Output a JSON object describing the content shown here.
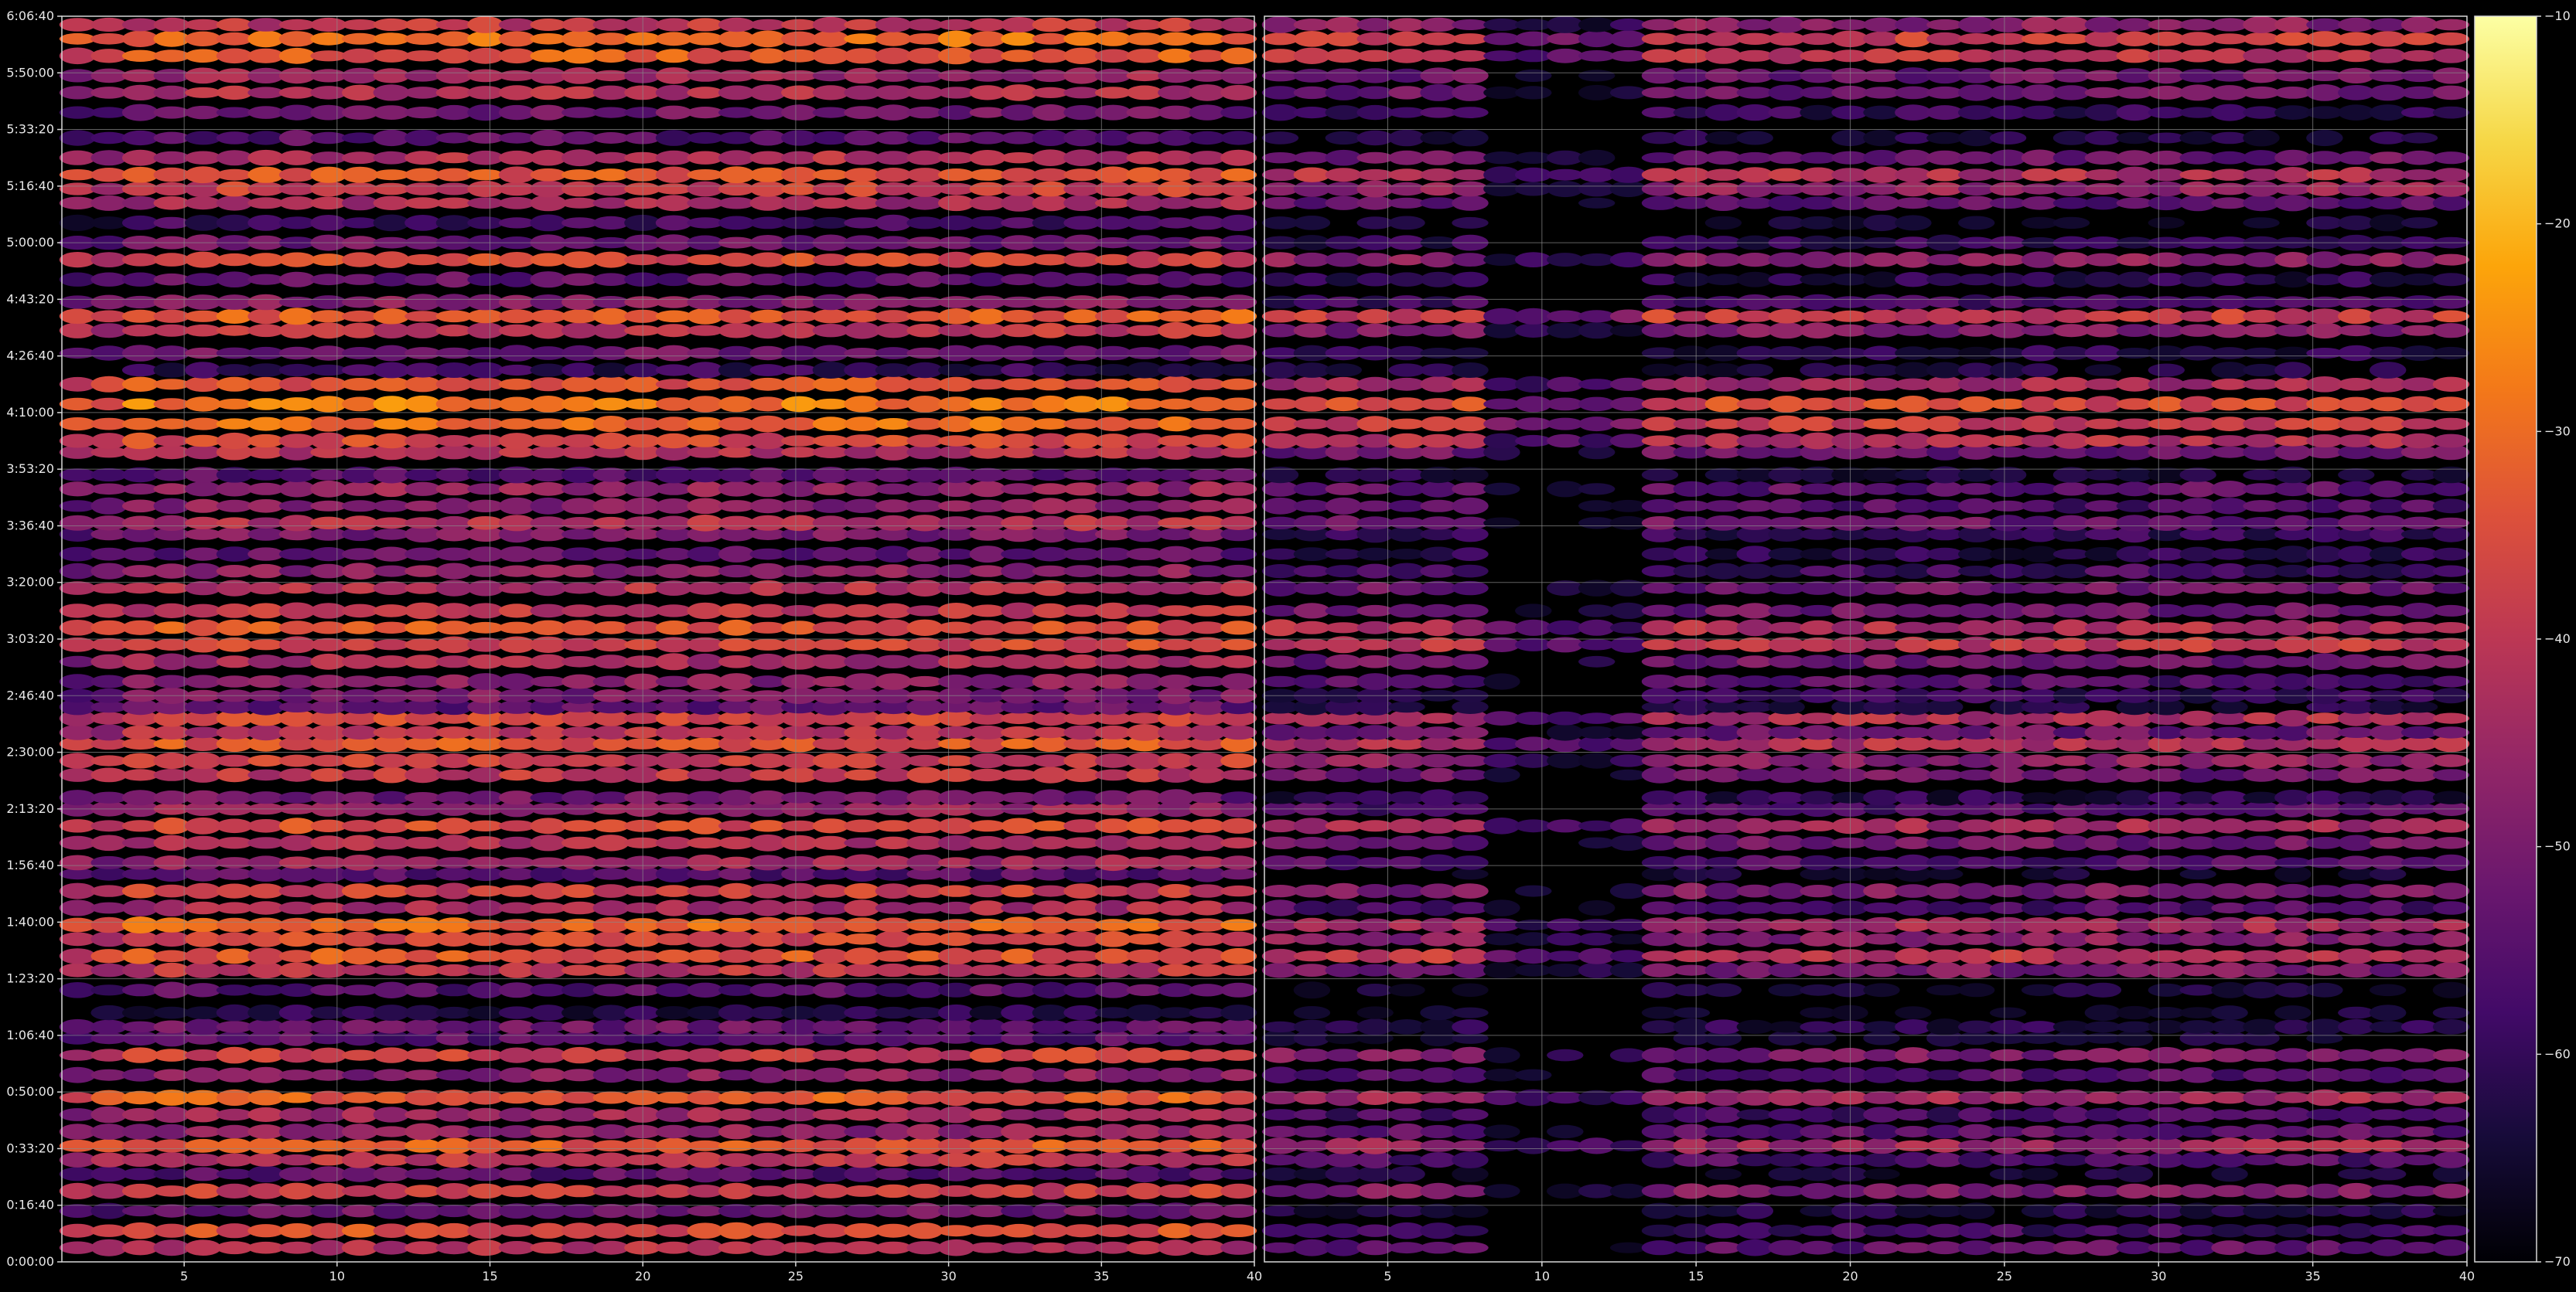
{
  "chart_data": {
    "type": "heatmap",
    "colormap": "inferno",
    "background": "#000000",
    "grid": true,
    "panels": [
      {
        "name": "left",
        "xlim": [
          1,
          40
        ],
        "xticks": [
          5,
          10,
          15,
          20,
          25,
          30,
          35,
          40
        ],
        "ylim": [
          0,
          22000
        ],
        "yticks": [
          0,
          1000,
          2000,
          3000,
          4000,
          5000,
          6000,
          7000,
          8000,
          9000,
          10000,
          11000,
          12000,
          13000,
          14000,
          15000,
          16000,
          17000,
          18000,
          19000,
          20000,
          21000,
          22000
        ],
        "ytick_labels": [
          "0:00:00",
          "0:16:40",
          "0:33:20",
          "0:50:00",
          "1:06:40",
          "1:23:20",
          "1:40:00",
          "1:56:40",
          "2:13:20",
          "2:30:00",
          "2:46:40",
          "3:03:20",
          "3:20:00",
          "3:36:40",
          "3:53:20",
          "4:10:00",
          "4:26:40",
          "4:43:20",
          "5:00:00",
          "5:16:40",
          "5:33:20",
          "5:50:00",
          "6:06:40"
        ]
      },
      {
        "name": "right",
        "xlim": [
          1,
          40
        ],
        "xticks": [
          5,
          10,
          15,
          20,
          25,
          30,
          35,
          40
        ],
        "ylim": [
          0,
          22000
        ]
      }
    ],
    "colorbar": {
      "vmin": -70,
      "vmax": -10,
      "ticks": [
        -10,
        -20,
        -30,
        -40,
        -50,
        -60,
        -70
      ],
      "tick_labels": [
        "−10",
        "−20",
        "−30",
        "−40",
        "−50",
        "−60",
        "−70"
      ]
    },
    "band_rows": {
      "comment_free": true,
      "times": [
        250,
        550,
        900,
        1250,
        1550,
        1800,
        2050,
        2300,
        2600,
        2900,
        3300,
        3650,
        3950,
        4150,
        4400,
        4800,
        5150,
        5400,
        5700,
        5950,
        6250,
        6550,
        6850,
        7050,
        7400,
        7700,
        8000,
        8200,
        8600,
        8850,
        9150,
        9350,
        9600,
        9800,
        10000,
        10250,
        10600,
        10900,
        11200,
        11500,
        11900,
        12200,
        12500,
        12850,
        13050,
        13350,
        13650,
        13900,
        14300,
        14500,
        14800,
        15150,
        15500,
        15750,
        16050,
        16450,
        16700,
        16950,
        17350,
        17700,
        18000,
        18350,
        18700,
        18950,
        19200,
        19500,
        19850,
        20300,
        20650,
        20950,
        21300,
        21600,
        21850
      ],
      "left_level": [
        -42,
        -35,
        -52,
        -38,
        -55,
        -40,
        -33,
        -47,
        -45,
        -32,
        -48,
        -38,
        -55,
        -52,
        -62,
        -55,
        -40,
        -34,
        -36,
        -31,
        -43,
        -38,
        -55,
        -45,
        -42,
        -36,
        -45,
        -52,
        -40,
        -38,
        -34,
        -42,
        -36,
        -54,
        -50,
        -48,
        -44,
        -36,
        -34,
        -40,
        -42,
        -48,
        -54,
        -50,
        -42,
        -48,
        -46,
        -55,
        -42,
        -36,
        -30,
        -28,
        -34,
        -60,
        -52,
        -40,
        -32,
        -48,
        -54,
        -36,
        -52,
        -58,
        -44,
        -38,
        -34,
        -42,
        -55,
        -52,
        -42,
        -45,
        -33,
        -30,
        -40
      ],
      "right_level": [
        -54,
        -58,
        -64,
        -50,
        -66,
        -56,
        -44,
        -54,
        -58,
        -44,
        -55,
        -50,
        -66,
        -62,
        -65,
        -64,
        -50,
        -40,
        -48,
        -44,
        -56,
        -50,
        -66,
        -56,
        -52,
        -44,
        -56,
        -62,
        -52,
        -48,
        -42,
        -52,
        -42,
        -64,
        -60,
        -56,
        -52,
        -40,
        -42,
        -52,
        -52,
        -58,
        -62,
        -60,
        -52,
        -56,
        -54,
        -64,
        -52,
        -42,
        -38,
        -36,
        -44,
        -64,
        -62,
        -50,
        -38,
        -58,
        -62,
        -48,
        -60,
        -66,
        -54,
        -46,
        -42,
        -52,
        -64,
        -60,
        -52,
        -52,
        -40,
        -38,
        -48
      ],
      "right_dark_start": 7,
      "right_dark_end": 11
    }
  }
}
